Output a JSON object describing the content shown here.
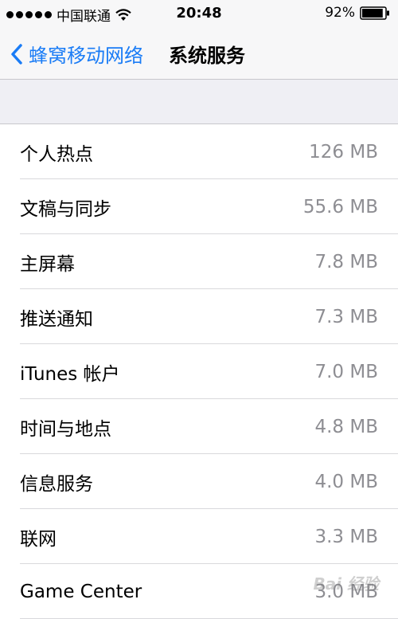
{
  "status_bar": {
    "carrier": "中国联通",
    "time": "20:48",
    "battery_percent": "92%",
    "battery_level": 0.92,
    "signal_icon": "signal-dots-icon",
    "wifi_icon": "wifi-icon"
  },
  "nav": {
    "back_label": "蜂窝移动网络",
    "title": "系统服务",
    "back_icon": "chevron-left-icon",
    "accent_color": "#1a7cf6"
  },
  "list": {
    "items": [
      {
        "label": "个人热点",
        "value": "126 MB"
      },
      {
        "label": "文稿与同步",
        "value": "55.6 MB"
      },
      {
        "label": "主屏幕",
        "value": "7.8 MB"
      },
      {
        "label": "推送通知",
        "value": "7.3 MB"
      },
      {
        "label": "iTunes 帐户",
        "value": "7.0 MB"
      },
      {
        "label": "时间与地点",
        "value": "4.8 MB"
      },
      {
        "label": "信息服务",
        "value": "4.0 MB"
      },
      {
        "label": "联网",
        "value": "3.3 MB"
      },
      {
        "label": "Game Center",
        "value": "3.0 MB"
      }
    ]
  },
  "watermark": {
    "text": "Bai 经验"
  }
}
